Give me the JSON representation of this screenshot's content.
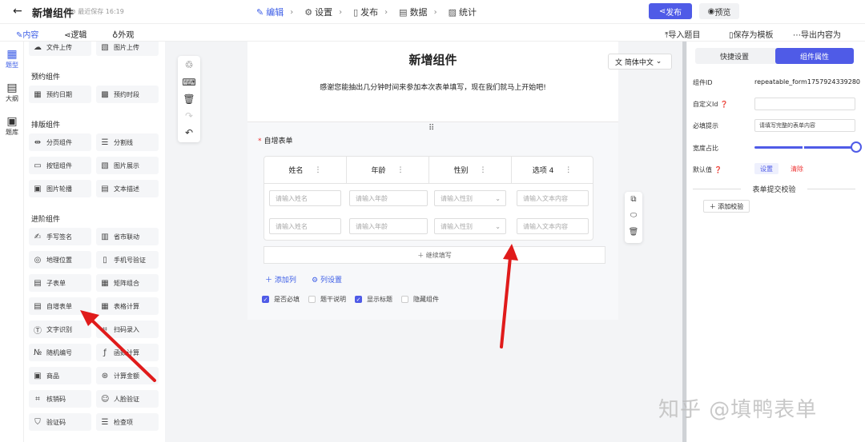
{
  "app": {
    "back_icon": "arrow-left-icon",
    "title": "新增组件",
    "save_status": "最近保存 16:19"
  },
  "steps": [
    {
      "label": "编辑",
      "icon": "edit-icon",
      "active": true
    },
    {
      "label": "设置",
      "icon": "gear-icon",
      "active": false
    },
    {
      "label": "发布",
      "icon": "document-icon",
      "active": false
    },
    {
      "label": "数据",
      "icon": "database-icon",
      "active": false
    },
    {
      "label": "统计",
      "icon": "stats-icon",
      "active": false
    }
  ],
  "actions": {
    "publish": "发布",
    "preview": "预览"
  },
  "modes": [
    "内容",
    "逻辑",
    "外观"
  ],
  "tools_right": [
    "导入题目",
    "保存为模板",
    "导出内容为"
  ],
  "rail": [
    "题型",
    "大纲",
    "题库"
  ],
  "panel": {
    "top_items": [
      "文件上传",
      "图片上传"
    ],
    "groups": [
      {
        "title": "预约组件",
        "items": [
          "预约日期",
          "预约时段"
        ]
      },
      {
        "title": "排版组件",
        "items": [
          "分页组件",
          "分割线",
          "按钮组件",
          "图片展示",
          "图片轮播",
          "文本描述"
        ]
      },
      {
        "title": "进阶组件",
        "items": [
          "手写签名",
          "省市联动",
          "地理位置",
          "手机号验证",
          "子表单",
          "矩阵组合",
          "自增表单",
          "表格计算",
          "文字识别",
          "扫码录入",
          "随机编号",
          "函数计算",
          "商品",
          "计算金额",
          "核销码",
          "人脸验证",
          "验证码",
          "检查项"
        ]
      }
    ]
  },
  "form": {
    "title": "新增组件",
    "language": "简体中文",
    "description": "感谢您能抽出几分钟时间来参加本次表单填写，现在我们就马上开始吧!",
    "field_label": "自增表单",
    "columns": [
      "姓名",
      "年龄",
      "性别",
      "选项 4"
    ],
    "rows": [
      [
        "请输入姓名",
        "请输入年龄",
        "请输入性别",
        "请输入文本内容"
      ],
      [
        "请输入姓名",
        "请输入年龄",
        "请输入性别",
        "请输入文本内容"
      ]
    ],
    "continue_label": "继续填写",
    "add_column": "添加列",
    "column_settings": "列设置",
    "options": [
      {
        "label": "是否必填",
        "checked": true
      },
      {
        "label": "题干说明",
        "checked": false
      },
      {
        "label": "显示标题",
        "checked": true
      },
      {
        "label": "隐藏组件",
        "checked": false
      }
    ]
  },
  "props": {
    "tabs": [
      "快捷设置",
      "组件属性"
    ],
    "active_tab": 1,
    "component_id_label": "组件ID",
    "component_id": "repeatable_form1757924339280",
    "custom_id_label": "自定义Id",
    "custom_id_value": "",
    "required_hint_label": "必填提示",
    "required_hint_value": "请填写完整的表单内容",
    "width_label": "宽度占比",
    "width_ratio": 1.0,
    "default_label": "默认值",
    "set_label": "设置",
    "clear_label": "清除",
    "validation_title": "表单提交校验",
    "add_validation": "添加校验"
  },
  "colors": {
    "accent": "#4f5be7",
    "arrow": "#e01b1b",
    "danger": "#e33333"
  },
  "watermark": "知乎 @填鸭表单"
}
